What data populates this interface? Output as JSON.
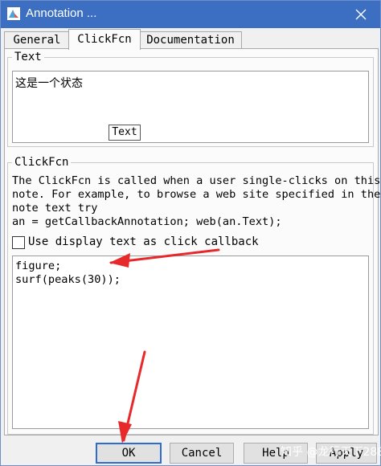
{
  "window": {
    "title": "Annotation ..."
  },
  "tabs": [
    {
      "label": "General",
      "active": false
    },
    {
      "label": "ClickFcn",
      "active": true
    },
    {
      "label": "Documentation",
      "active": false
    }
  ],
  "text_group": {
    "legend": "Text",
    "value": "这是一个状态",
    "text_button_label": "Text"
  },
  "clickfcn_group": {
    "legend": "ClickFcn",
    "description_lines": [
      "The ClickFcn is called when a user single-clicks on this",
      "note. For example, to browse a web site specified in the",
      "note text try",
      "an = getCallbackAnnotation; web(an.Text);"
    ],
    "checkbox_label": "Use display text as click callback",
    "checkbox_checked": false,
    "code_lines": [
      "figure;",
      "surf(peaks(30));"
    ]
  },
  "buttons": {
    "ok": "OK",
    "cancel": "Cancel",
    "help": "Help",
    "apply": "Apply"
  },
  "watermark": "知乎 @龙行天下288",
  "colors": {
    "titlebar": "#3c6fc2",
    "annotation_arrow": "#e8292b",
    "default_button_border": "#2f6bd1"
  },
  "icons": {
    "app": "matlab-annotation-icon",
    "close": "close-icon",
    "checkbox": "checkbox-icon",
    "arrow": "red-arrow-icon"
  }
}
